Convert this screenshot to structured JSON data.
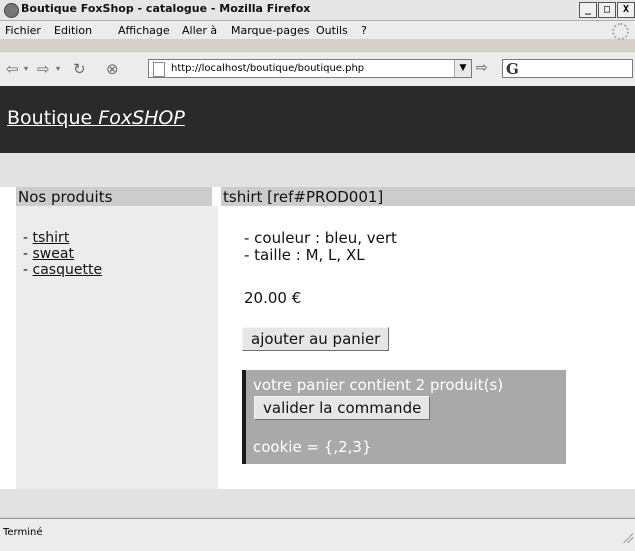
{
  "window": {
    "title": "Boutique FoxShop - catalogue - Mozilla Firefox",
    "controls": {
      "minimize": "_",
      "maximize": "□",
      "close": "X"
    }
  },
  "menu": {
    "items": [
      "Fichier",
      "Edition",
      "Affichage",
      "Aller à",
      "Marque-pages",
      "Outils",
      "?"
    ]
  },
  "navigation": {
    "url": "http://localhost/boutique/boutique.php",
    "icons": [
      "back-icon",
      "forward-icon",
      "reload-icon",
      "stop-icon",
      "go-icon",
      "google-search-icon"
    ]
  },
  "site": {
    "title_plain": "Boutique ",
    "title_em": "FoxSHOP"
  },
  "sidebar": {
    "title": "Nos produits",
    "products": [
      "tshirt",
      "sweat",
      "casquette"
    ]
  },
  "product": {
    "title": "tshirt [ref#PROD001]",
    "attributes": [
      "- couleur : bleu, vert",
      "- taille : M, L, XL"
    ],
    "price": "20.00 €",
    "add_label": "ajouter au panier"
  },
  "cart": {
    "text": "votre panier contient 2 produit(s)",
    "validate_label": "valider la commande",
    "cookie": "cookie = {,2,3}"
  },
  "status": {
    "text": "Terminé"
  }
}
